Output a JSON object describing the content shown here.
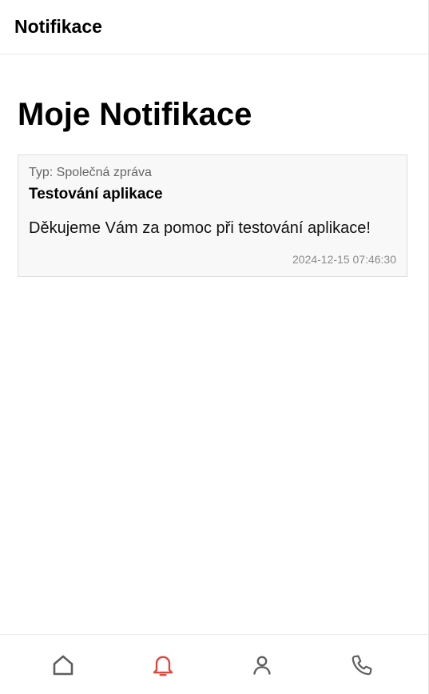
{
  "header": {
    "title": "Notifikace"
  },
  "page": {
    "heading": "Moje Notifikace"
  },
  "notifications": [
    {
      "type_label": "Typ: Společná zpráva",
      "title": "Testování aplikace",
      "message": "Děkujeme Vám za pomoc při testování aplikace!",
      "timestamp": "2024-12-15 07:46:30"
    }
  ],
  "bottom_nav": {
    "active": "notifications",
    "items": [
      {
        "id": "home",
        "icon": "home-icon"
      },
      {
        "id": "notifications",
        "icon": "bell-icon"
      },
      {
        "id": "profile",
        "icon": "user-icon"
      },
      {
        "id": "contact",
        "icon": "phone-icon"
      }
    ]
  },
  "colors": {
    "active_icon": "#e2473d",
    "inactive_icon": "#5f5f5f",
    "card_background": "#f8f8f8",
    "card_border": "#dedede"
  }
}
